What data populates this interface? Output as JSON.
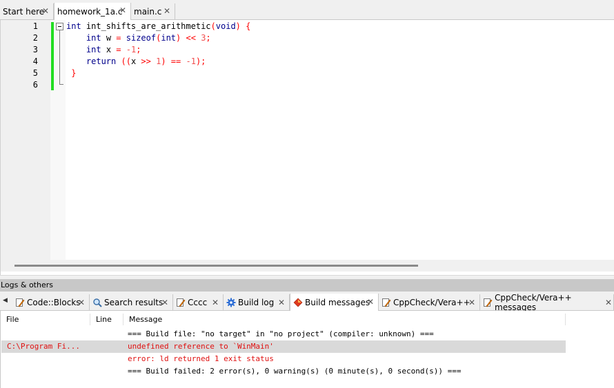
{
  "editor_tabs": [
    {
      "label": "Start here",
      "active": false
    },
    {
      "label": "homework_1a.c",
      "active": true
    },
    {
      "label": "main.c",
      "active": false
    }
  ],
  "tab_close_glyph": "✕",
  "line_numbers": [
    "1",
    "2",
    "3",
    "4",
    "5",
    "6"
  ],
  "code": {
    "l1": [
      "int",
      " int_shifts_are_arithmetic",
      "(",
      "void",
      ")",
      " {"
    ],
    "l2": [
      "    ",
      "int",
      " w ",
      "=",
      " ",
      "sizeof",
      "(",
      "int",
      ")",
      " ",
      "<<",
      " ",
      "3",
      ";"
    ],
    "l3": [
      "    ",
      "int",
      " x ",
      "=",
      " ",
      "-1",
      ";"
    ],
    "l4": [
      "    ",
      "return",
      " ",
      "((",
      "x ",
      ">>",
      " ",
      "1",
      ")",
      " ",
      "==",
      " ",
      "-1",
      ");"
    ],
    "l5": [
      " ",
      "}"
    ]
  },
  "logs_header": "Logs & others",
  "log_tabs": [
    {
      "label": "Code::Blocks",
      "icon": "document-pencil-icon",
      "active": false
    },
    {
      "label": "Search results",
      "icon": "magnifier-icon",
      "active": false
    },
    {
      "label": "Cccc",
      "icon": "document-pencil-icon",
      "active": false
    },
    {
      "label": "Build log",
      "icon": "gear-icon",
      "active": false
    },
    {
      "label": "Build messages",
      "icon": "diamond-icon",
      "active": true
    },
    {
      "label": "CppCheck/Vera++",
      "icon": "document-pencil-icon",
      "active": false
    },
    {
      "label": "CppCheck/Vera++ messages",
      "icon": "document-pencil-icon",
      "active": false
    }
  ],
  "colors": {
    "accent_green": "#22dd22",
    "error_red": "#e01010",
    "keyword_blue": "#00008b"
  },
  "messages": {
    "columns": [
      "File",
      "Line",
      "Message"
    ],
    "rows": [
      {
        "file": "",
        "line": "",
        "message": "=== Build file: \"no target\" in \"no project\" (compiler: unknown) ===",
        "color": "black",
        "selected": false
      },
      {
        "file": "C:\\Program Fi...",
        "line": "",
        "message": "undefined reference to `WinMain'",
        "color": "red",
        "selected": true
      },
      {
        "file": "",
        "line": "",
        "message": "error: ld returned 1 exit status",
        "color": "red",
        "selected": false
      },
      {
        "file": "",
        "line": "",
        "message": "=== Build failed: 2 error(s), 0 warning(s) (0 minute(s), 0 second(s)) ===",
        "color": "black",
        "selected": false
      }
    ]
  }
}
